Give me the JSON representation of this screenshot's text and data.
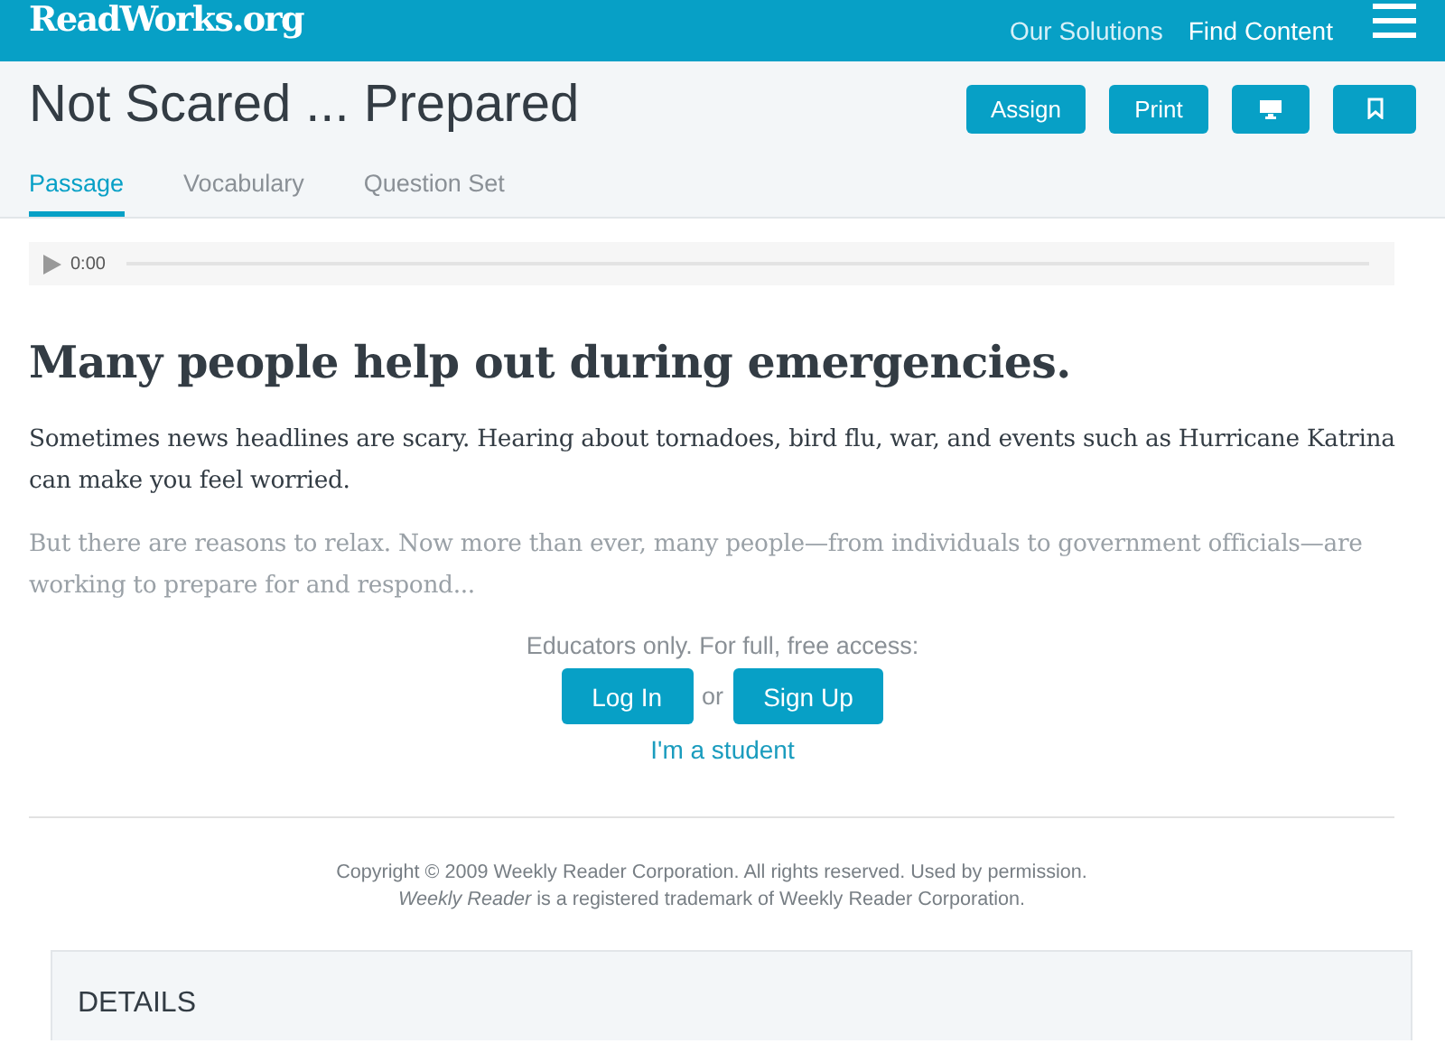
{
  "header": {
    "logo": "ReadWorks.org",
    "nav": [
      "Our Solutions",
      "Find Content"
    ]
  },
  "title": "Not Scared ... Prepared",
  "actions": [
    {
      "kind": "text",
      "label": "Assign"
    },
    {
      "kind": "text",
      "label": "Print"
    },
    {
      "kind": "monitor"
    },
    {
      "kind": "bookmark"
    }
  ],
  "tabs": [
    {
      "label": "Passage",
      "selected": true
    },
    {
      "label": "Vocabulary",
      "selected": false
    },
    {
      "label": "Question Set",
      "selected": false
    }
  ],
  "audio": {
    "time": "0:00"
  },
  "article": {
    "heading": "Many people help out during emergencies.",
    "paragraphs": [
      {
        "text": "Sometimes news headlines are scary. Hearing about tornadoes, bird flu, war, and events such as Hurricane Katrina can make you feel worried.",
        "faded": false
      },
      {
        "text": "But there are reasons to relax. Now more than ever, many people—from individuals to government officials—are working to prepare for and respond...",
        "faded": true
      }
    ]
  },
  "access": {
    "prompt": "Educators only. For full, free access:",
    "login": "Log In",
    "or": "or",
    "signup": "Sign Up",
    "student": "I'm a student"
  },
  "copyright": [
    "Copyright © 2009 Weekly Reader Corporation. All rights reserved. Used by permission.",
    "*Weekly Reader* is a registered trademark of Weekly Reader Corporation."
  ],
  "details": {
    "heading": "DETAILS"
  }
}
